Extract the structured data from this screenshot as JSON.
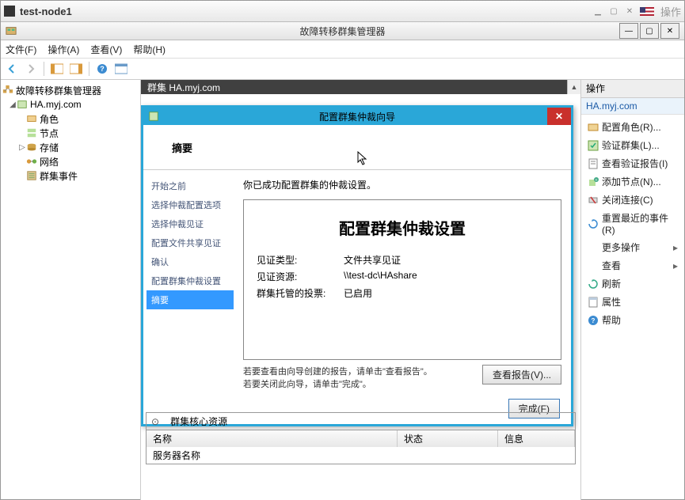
{
  "outer_title": "test-node1",
  "outer_ops": "操作",
  "inner_title": "故障转移群集管理器",
  "menu": {
    "file": "文件(F)",
    "action": "操作(A)",
    "view": "查看(V)",
    "help": "帮助(H)"
  },
  "tree": {
    "root": "故障转移群集管理器",
    "cluster": "HA.myj.com",
    "nodes": [
      "角色",
      "节点",
      "存储",
      "网络",
      "群集事件"
    ]
  },
  "center_header": "群集 HA.myj.com",
  "actions": {
    "title": "操作",
    "subtitle": "HA.myj.com",
    "items": [
      "配置角色(R)...",
      "验证群集(L)...",
      "查看验证报告(I)",
      "添加节点(N)...",
      "关闭连接(C)",
      "重置最近的事件(R)",
      "更多操作",
      "查看",
      "刷新",
      "属性",
      "帮助"
    ]
  },
  "wizard": {
    "title": "配置群集仲裁向导",
    "header": "摘要",
    "message": "你已成功配置群集的仲裁设置。",
    "box_title": "配置群集仲裁设置",
    "rows": [
      {
        "k": "见证类型:",
        "v": "文件共享见证"
      },
      {
        "k": "见证资源:",
        "v": "\\\\test-dc\\HAshare"
      },
      {
        "k": "群集托管的投票:",
        "v": "已启用"
      }
    ],
    "steps": [
      "开始之前",
      "选择仲裁配置选项",
      "选择仲裁见证",
      "配置文件共享见证",
      "确认",
      "配置群集仲裁设置",
      "摘要"
    ],
    "note1": "若要查看由向导创建的报告，请单击\"查看报告\"。",
    "note2": "若要关闭此向导，请单击\"完成\"。",
    "view_report_btn": "查看报告(V)...",
    "finish_btn": "完成(F)"
  },
  "core": {
    "title": "群集核心资源",
    "cols": [
      "名称",
      "状态",
      "信息"
    ],
    "row1": "服务器名称"
  }
}
